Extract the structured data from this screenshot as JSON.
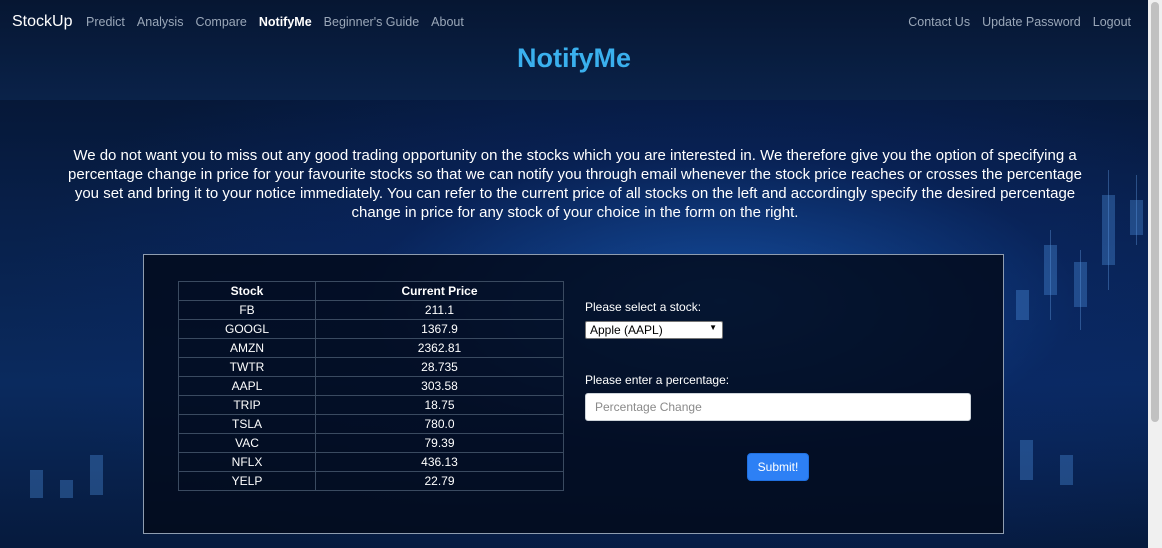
{
  "nav": {
    "brand": "StockUp",
    "left": [
      "Predict",
      "Analysis",
      "Compare",
      "NotifyMe",
      "Beginner's Guide",
      "About"
    ],
    "active": "NotifyMe",
    "right": [
      "Contact Us",
      "Update Password",
      "Logout"
    ]
  },
  "page": {
    "title": "NotifyMe",
    "intro": "We do not want you to miss out any good trading opportunity on the stocks which you are interested in. We therefore give you the option of specifying a percentage change in price for your favourite stocks so that we can notify you through email whenever the stock price reaches or crosses the percentage you set and bring it to your notice immediately. You can refer to the current price of all stocks on the left and accordingly specify the desired percentage change in price for any stock of your choice in the form on the right."
  },
  "table": {
    "headers": [
      "Stock",
      "Current Price"
    ],
    "rows": [
      [
        "FB",
        "211.1"
      ],
      [
        "GOOGL",
        "1367.9"
      ],
      [
        "AMZN",
        "2362.81"
      ],
      [
        "TWTR",
        "28.735"
      ],
      [
        "AAPL",
        "303.58"
      ],
      [
        "TRIP",
        "18.75"
      ],
      [
        "TSLA",
        "780.0"
      ],
      [
        "VAC",
        "79.39"
      ],
      [
        "NFLX",
        "436.13"
      ],
      [
        "YELP",
        "22.79"
      ]
    ]
  },
  "form": {
    "select_label": "Please select a stock:",
    "selected_stock": "Apple (AAPL)",
    "percent_label": "Please enter a percentage:",
    "percent_value": "",
    "percent_placeholder": "Percentage Change",
    "submit_label": "Submit!"
  },
  "colors": {
    "title": "#3ab0ee",
    "submit": "#2d80f5"
  }
}
